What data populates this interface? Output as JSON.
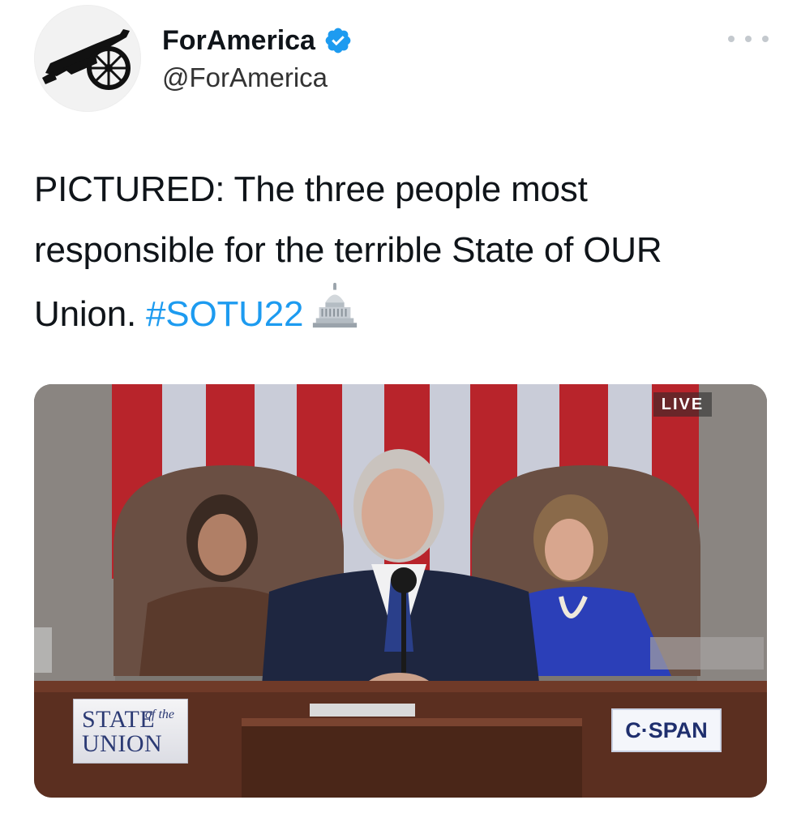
{
  "tweet": {
    "author": {
      "display_name": "ForAmerica",
      "handle": "@ForAmerica",
      "verified": true,
      "avatar_icon": "cannon-icon"
    },
    "text": {
      "body": "PICTURED: The three people most responsible for the terrible State of OUR Union.",
      "hashtag": "#SOTU22",
      "emoji_icon": "capitol-building-icon"
    },
    "media": {
      "live_badge": "LIVE",
      "logo_left": {
        "line1": "STATE",
        "line2": "of the",
        "line3": "UNION"
      },
      "logo_right": "C·SPAN"
    }
  },
  "colors": {
    "text": "#0f1419",
    "hashtag": "#1d9bf0",
    "verified": "#1d9bf0",
    "handle": "#333333"
  }
}
